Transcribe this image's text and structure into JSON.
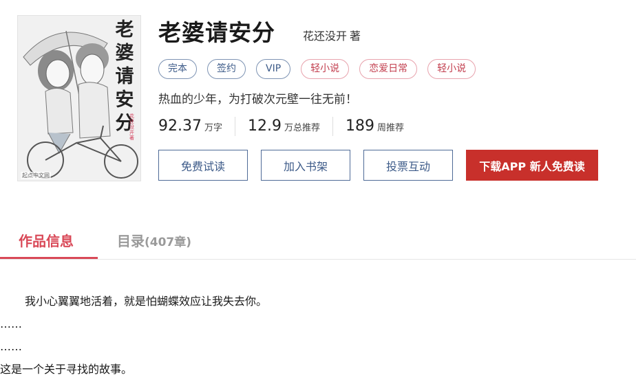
{
  "book": {
    "title": "老婆请安分",
    "author": "花还没开",
    "author_suffix": "著",
    "cover": {
      "title_chars": [
        "老",
        "婆",
        "请",
        "安",
        "分"
      ],
      "author_text": "花还没开著",
      "watermark": "起点中文网"
    },
    "tags": [
      {
        "label": "完本",
        "style": "blue"
      },
      {
        "label": "签约",
        "style": "blue"
      },
      {
        "label": "VIP",
        "style": "blue"
      },
      {
        "label": "轻小说",
        "style": "red"
      },
      {
        "label": "恋爱日常",
        "style": "red"
      },
      {
        "label": "轻小说",
        "style": "red"
      }
    ],
    "intro": "热血的少年，为打破次元壁一往无前！",
    "stats": [
      {
        "value": "92.37",
        "unit": "万字"
      },
      {
        "value": "12.9",
        "unit": "万总推荐"
      },
      {
        "value": "189",
        "unit": "周推荐"
      }
    ]
  },
  "actions": {
    "free_read": "免费试读",
    "add_shelf": "加入书架",
    "vote": "投票互动",
    "download": "下载APP  新人免费读"
  },
  "tabs": {
    "info": "作品信息",
    "catalog": "目录",
    "catalog_count": "(407章)"
  },
  "description": [
    "我小心翼翼地活着，就是怕蝴蝶效应让我失去你。",
    "……",
    "……",
    "这是一个关于寻找的故事。"
  ],
  "colors": {
    "accent_red": "#d94857",
    "button_red": "#c8302b",
    "tag_blue": "#3c5a88",
    "tag_red": "#c23d4d"
  }
}
